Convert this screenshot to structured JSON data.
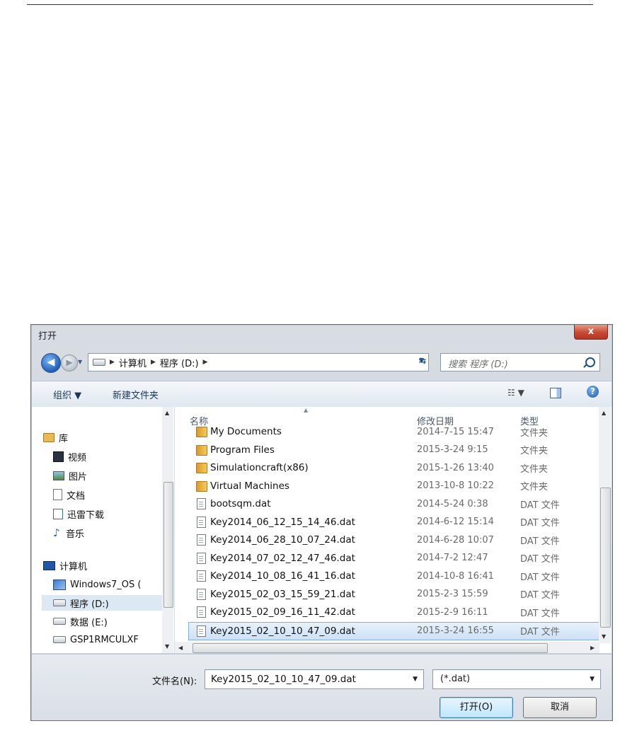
{
  "dialog": {
    "title": "打开",
    "close_label": "x"
  },
  "address": {
    "crumbs": [
      "计算机",
      "程序 (D:)"
    ],
    "search_placeholder": "搜索 程序 (D:)"
  },
  "toolbar": {
    "organize": "组织 ▼",
    "new_folder": "新建文件夹",
    "view_label": "☷ ▼",
    "help": "?"
  },
  "navpane": {
    "items": [
      {
        "label": "库",
        "icon": "library-icon"
      },
      {
        "label": "视频",
        "icon": "video-icon"
      },
      {
        "label": "图片",
        "icon": "pictures-icon"
      },
      {
        "label": "文档",
        "icon": "documents-icon"
      },
      {
        "label": "迅雷下载",
        "icon": "download-icon"
      },
      {
        "label": "音乐",
        "icon": "music-icon"
      },
      {
        "label": "计算机",
        "icon": "computer-icon"
      },
      {
        "label": "Windows7_OS (",
        "icon": "os-drive-icon"
      },
      {
        "label": "程序 (D:)",
        "icon": "drive-icon",
        "selected": true
      },
      {
        "label": "数据 (E:)",
        "icon": "drive-icon"
      },
      {
        "label": "GSP1RMCULXF",
        "icon": "drive-icon"
      }
    ]
  },
  "columns": {
    "name": "名称",
    "date": "修改日期",
    "type": "类型"
  },
  "files": [
    {
      "name": "My Documents",
      "date": "2014-7-15 15:47",
      "type": "文件夹",
      "kind": "folder"
    },
    {
      "name": "Program Files",
      "date": "2015-3-24 9:15",
      "type": "文件夹",
      "kind": "folder"
    },
    {
      "name": "Simulationcraft(x86)",
      "date": "2015-1-26 13:40",
      "type": "文件夹",
      "kind": "folder"
    },
    {
      "name": "Virtual Machines",
      "date": "2013-10-8 10:22",
      "type": "文件夹",
      "kind": "folder"
    },
    {
      "name": "bootsqm.dat",
      "date": "2014-5-24 0:38",
      "type": "DAT 文件",
      "kind": "file"
    },
    {
      "name": "Key2014_06_12_15_14_46.dat",
      "date": "2014-6-12 15:14",
      "type": "DAT 文件",
      "kind": "file"
    },
    {
      "name": "Key2014_06_28_10_07_24.dat",
      "date": "2014-6-28 10:07",
      "type": "DAT 文件",
      "kind": "file"
    },
    {
      "name": "Key2014_07_02_12_47_46.dat",
      "date": "2014-7-2 12:47",
      "type": "DAT 文件",
      "kind": "file"
    },
    {
      "name": "Key2014_10_08_16_41_16.dat",
      "date": "2014-10-8 16:41",
      "type": "DAT 文件",
      "kind": "file"
    },
    {
      "name": "Key2015_02_03_15_59_21.dat",
      "date": "2015-2-3 15:59",
      "type": "DAT 文件",
      "kind": "file"
    },
    {
      "name": "Key2015_02_09_16_11_42.dat",
      "date": "2015-2-9 16:11",
      "type": "DAT 文件",
      "kind": "file"
    },
    {
      "name": "Key2015_02_10_10_47_09.dat",
      "date": "2015-3-24 16:55",
      "type": "DAT 文件",
      "kind": "file",
      "selected": true
    }
  ],
  "bottom": {
    "filename_label": "文件名(N):",
    "filename_value": "Key2015_02_10_10_47_09.dat",
    "filter_value": "(*.dat)",
    "open_label": "打开(O)",
    "cancel_label": "取消"
  }
}
